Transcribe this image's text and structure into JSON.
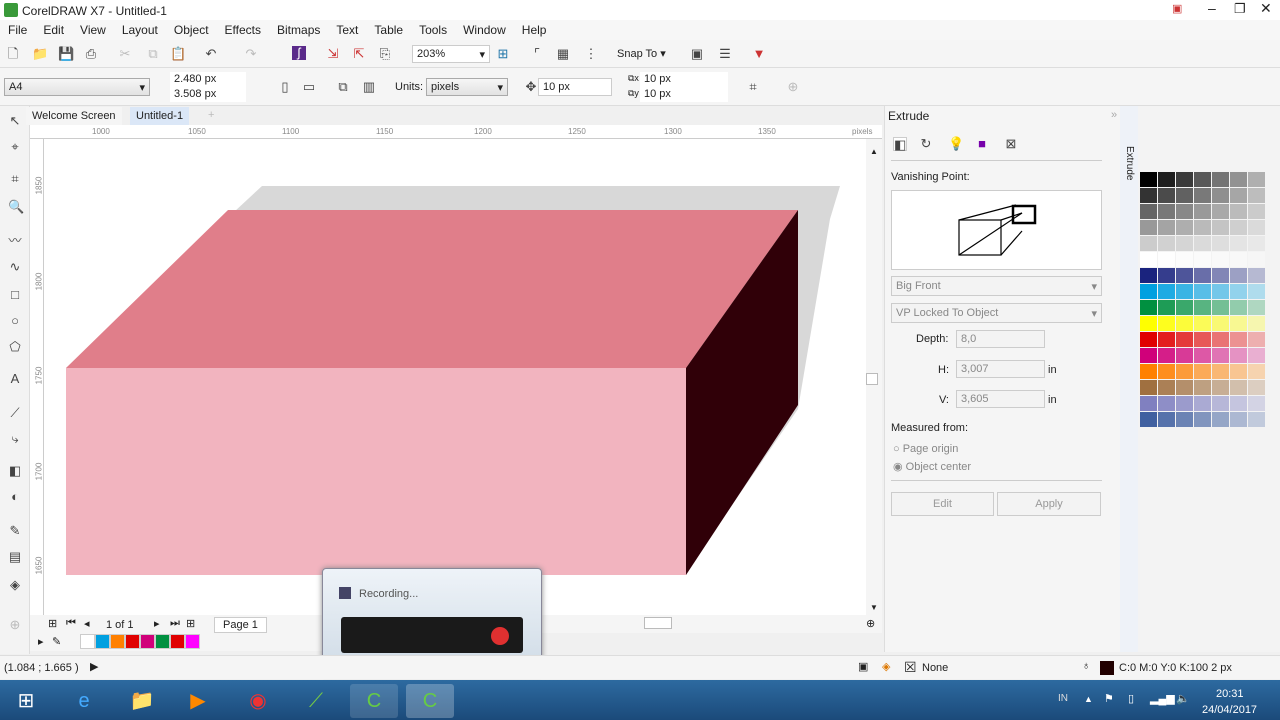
{
  "window": {
    "title": "CorelDRAW X7 - Untitled-1"
  },
  "menu": [
    "File",
    "Edit",
    "View",
    "Layout",
    "Object",
    "Effects",
    "Bitmaps",
    "Text",
    "Table",
    "Tools",
    "Window",
    "Help"
  ],
  "toolbar": {
    "zoom": "203%",
    "snap_to": "Snap To"
  },
  "property_bar": {
    "page_size": "A4",
    "width": "2.480 px",
    "height": "3.508 px",
    "units_label": "Units:",
    "units": "pixels",
    "nudge": "10 px",
    "dup_x": "10 px",
    "dup_y": "10 px"
  },
  "tabs": [
    "Welcome Screen",
    "Untitled-1"
  ],
  "ruler": {
    "h_labels": [
      "1000",
      "1050",
      "1100",
      "1150",
      "1200",
      "1250",
      "1300",
      "1350"
    ],
    "h_unit": "pixels",
    "v_labels": [
      "1850",
      "1800",
      "1750",
      "1700",
      "1650"
    ]
  },
  "colors": {
    "top": "#e07e8a",
    "front": "#f2b4bf",
    "side": "#300008",
    "shadow": "#d8d8d8"
  },
  "page_nav": {
    "count": "1 of 1",
    "page": "Page 1"
  },
  "recording": {
    "label": "Recording..."
  },
  "extrude": {
    "title": "Extrude",
    "vanishing_point": "Vanishing Point:",
    "type": "Big Front",
    "vp": "VP Locked To Object",
    "depth_label": "Depth:",
    "depth": "8,0",
    "h_label": "H:",
    "h": "3,007",
    "v_label": "V:",
    "v": "3,605",
    "unit": "in",
    "measured": "Measured from:",
    "opt1": "Page origin",
    "opt2": "Object center",
    "edit": "Edit",
    "apply": "Apply"
  },
  "status": {
    "coords": "(1.084 ; 1.665 )",
    "fill": "None",
    "outline": "C:0 M:0 Y:0 K:100  2 px"
  },
  "tray": {
    "lang": "IN",
    "time": "20:31",
    "date": "24/04/2017"
  },
  "palette": [
    "#000000",
    "#333333",
    "#666666",
    "#999999",
    "#cccccc",
    "#ffffff",
    "#1a237e",
    "#00a0e0",
    "#009040",
    "#ffff00",
    "#e00000",
    "#d0007a",
    "#ff8000",
    "#a07040",
    "#8080c0",
    "#4060a0"
  ]
}
